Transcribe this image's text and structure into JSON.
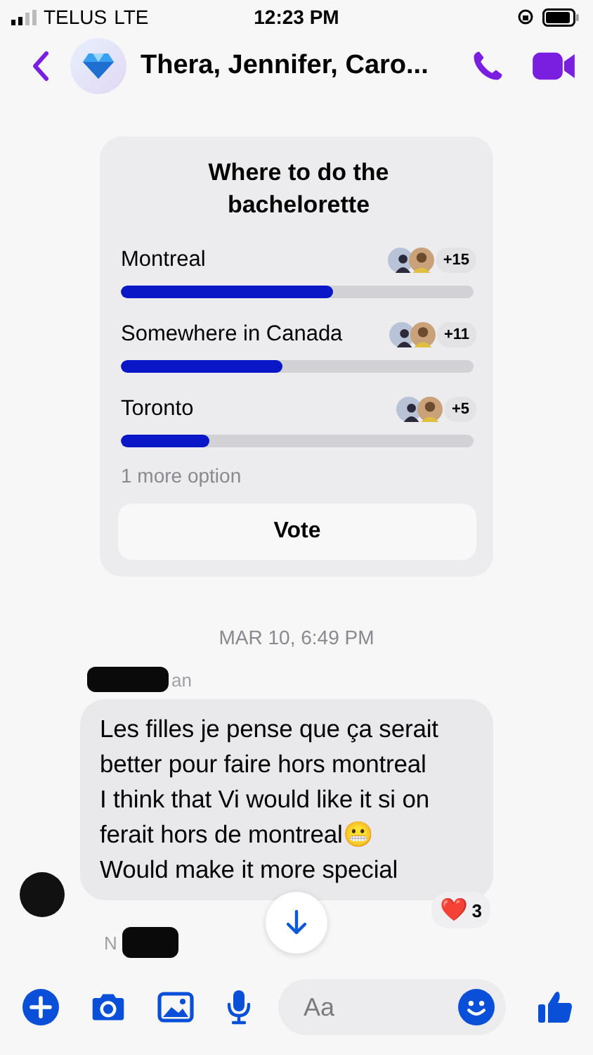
{
  "status_bar": {
    "carrier": "TELUS",
    "network": "LTE",
    "time": "12:23 PM"
  },
  "header": {
    "title": "Thera, Jennifer, Caro..."
  },
  "poll": {
    "title": "Where to do the bachelorette",
    "options": [
      {
        "label": "Montreal",
        "level": 0.6,
        "count": "+15"
      },
      {
        "label": "Somewhere in Canada",
        "level": 0.46,
        "count": "+11"
      },
      {
        "label": "Toronto",
        "level": 0.25,
        "count": "+5"
      }
    ],
    "more": "1 more option",
    "button": "Vote"
  },
  "timestamp": "MAR 10, 6:49 PM",
  "messages": [
    {
      "sender": "an",
      "lines": [
        "Les filles je pense que ça serait",
        "better pour faire hors montreal",
        "I think that Vi would like it si on",
        "ferait hors de montreal😬",
        "Would make it more special"
      ],
      "reaction": {
        "emoji": "❤️",
        "count": "3"
      }
    }
  ],
  "next_sender": "N",
  "composer": {
    "placeholder": "Aa"
  }
}
